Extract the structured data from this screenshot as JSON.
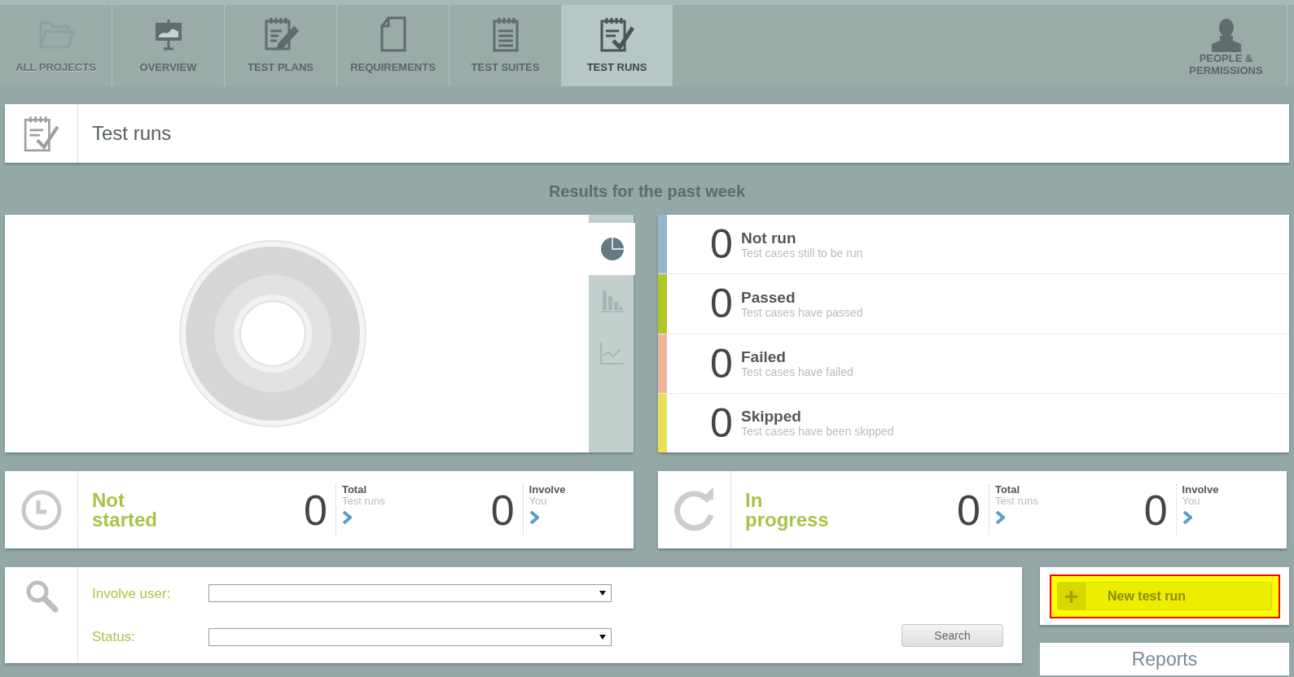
{
  "nav": {
    "tabs": [
      {
        "kind": "folder",
        "label": "ALL PROJECTS",
        "selected": false,
        "disabled": true
      },
      {
        "kind": "presentation",
        "label": "OVERVIEW",
        "selected": false,
        "disabled": false
      },
      {
        "kind": "notepad-pencil",
        "label": "TEST PLANS",
        "selected": false,
        "disabled": false
      },
      {
        "kind": "document",
        "label": "REQUIREMENTS",
        "selected": false,
        "disabled": false
      },
      {
        "kind": "notepad",
        "label": "TEST SUITES",
        "selected": false,
        "disabled": false
      },
      {
        "kind": "notepad-check",
        "label": "TEST RUNS",
        "selected": true,
        "disabled": false
      }
    ],
    "people": {
      "label_lines": [
        "PEOPLE &",
        "PERMISSIONS"
      ]
    }
  },
  "page_header": {
    "title": "Test runs"
  },
  "results": {
    "title": "Results for the past week",
    "chart_views": [
      {
        "kind": "pie",
        "selected": true
      },
      {
        "kind": "bar",
        "selected": false
      },
      {
        "kind": "line",
        "selected": false
      }
    ],
    "statuses": [
      {
        "count": "0",
        "name": "Not run",
        "description": "Test cases still to be run",
        "color": "#93b8c9"
      },
      {
        "count": "0",
        "name": "Passed",
        "description": "Test cases have passed",
        "color": "#afc627"
      },
      {
        "count": "0",
        "name": "Failed",
        "description": "Test cases have failed",
        "color": "#f0b39b"
      },
      {
        "count": "0",
        "name": "Skipped",
        "description": "Test cases have been skipped",
        "color": "#e8e05a"
      }
    ]
  },
  "summaries": [
    {
      "kind": "clock",
      "title_lines": [
        "Not",
        "started"
      ],
      "total": {
        "count": "0",
        "label": "Total",
        "sublabel": "Test runs"
      },
      "involve": {
        "count": "0",
        "label": "Involve",
        "sublabel": "You"
      }
    },
    {
      "kind": "refresh",
      "title_lines": [
        "In",
        "progress"
      ],
      "total": {
        "count": "0",
        "label": "Total",
        "sublabel": "Test runs"
      },
      "involve": {
        "count": "0",
        "label": "Involve",
        "sublabel": "You"
      }
    }
  ],
  "filter": {
    "fields": [
      {
        "label": "Involve user:"
      },
      {
        "label": "Status:"
      }
    ],
    "search_button": "Search"
  },
  "new_test_run": {
    "plus": "+",
    "label": "New test run",
    "highlighted": true
  },
  "reports": {
    "title": "Reports"
  }
}
